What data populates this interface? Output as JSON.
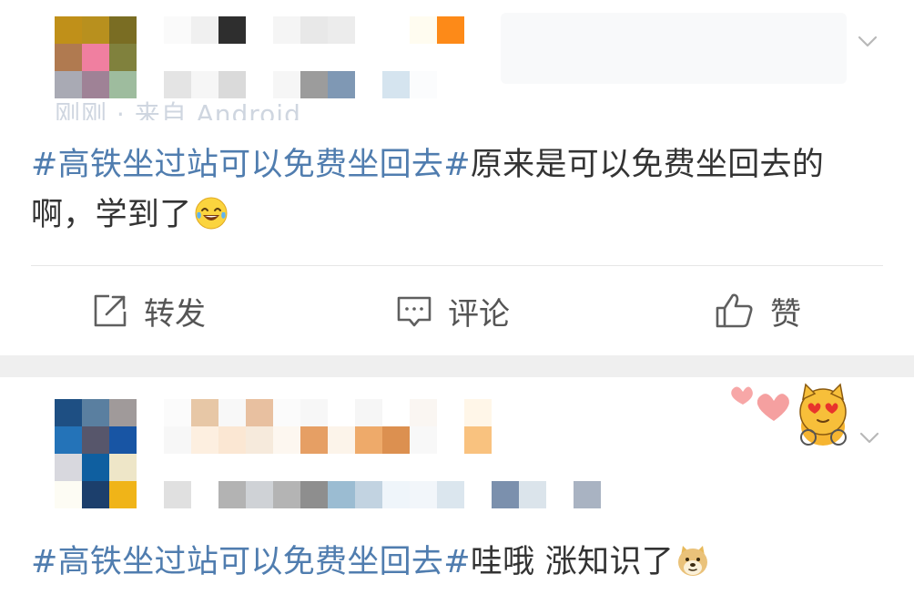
{
  "post1": {
    "author_meta_partial": "刚刚 · 来自 Android",
    "text": {
      "topic": "#高铁坐过站可以免费坐回去#",
      "body": "原来是可以免费坐回去的啊，学到了"
    },
    "emoji": "laugh-cry-emoji",
    "actions": {
      "repost": "转发",
      "comment": "评论",
      "like": "赞"
    }
  },
  "post2": {
    "text": {
      "topic": "#高铁坐过站可以免费坐回去#",
      "body": "哇哦 涨知识了"
    },
    "emoji": "doge-emoji",
    "sticker": "heart-eyes-cat-sticker"
  },
  "colors": {
    "topic_link": "#507daf",
    "text": "#333333",
    "separator": "#efefef"
  },
  "mosaic": {
    "avatar1": [
      "#c09019",
      "#b8901e",
      "#7a6d23",
      "#b07a50",
      "#f07fa0",
      "#80813d",
      "#a9aab4",
      "#9f8296",
      "#9ebc9e"
    ],
    "name1": [
      "#fafafa",
      "#f0f0f0",
      "#2e2e2e",
      "#ffffff",
      "#f5f5f5",
      "#e8e8e8",
      "#ececec",
      "#ffffff",
      "#ffffff",
      "#fffcf0",
      "#fd8a18"
    ],
    "meta1": [
      "#e4e4e4",
      "#f6f6f6",
      "#dadada",
      "#ffffff",
      "#f6f6f6",
      "#9c9c9c",
      "#7f98b4",
      "#ffffff",
      "#d5e4ef",
      "#fbfcfd",
      "#ffffff"
    ],
    "avatar2": [
      "#1e4f83",
      "#5a7fa0",
      "#a09a9a",
      "#2473b8",
      "#57566b",
      "#1855a4",
      "#d8d8de",
      "#0f5fa0",
      "#eee6c8",
      "#fdfcf4",
      "#1c3f6c",
      "#f0b418"
    ],
    "name2": [
      "#fbfbfb",
      "#e7c7a6",
      "#f8f8f8",
      "#e8c0a0",
      "#fbfbfb",
      "#f7f7f7",
      "#ffffff",
      "#f6f6f6",
      "#ffffff",
      "#faf6f2",
      "#ffffff",
      "#fff6e8",
      "#ffffff",
      "#f7f7f7",
      "#fdefe0",
      "#fbe7d3",
      "#f6eadc",
      "#fdf7f0",
      "#e69f64",
      "#fcf4ea",
      "#eeaa6a",
      "#dc9050",
      "#f8f8f8",
      "#ffffff",
      "#f9c27f",
      "#ffffff"
    ],
    "meta2": [
      "#e0e0e0",
      "#ffffff",
      "#b3b3b3",
      "#cfd2d6",
      "#b4b4b4",
      "#8e8e8e",
      "#9bbcd2",
      "#c2d3e1",
      "#eff5fa",
      "#f2f6fa",
      "#dbe6ee",
      "#ffffff",
      "#7b90ad",
      "#dbe4eb",
      "#ffffff",
      "#a9b3c2"
    ]
  }
}
